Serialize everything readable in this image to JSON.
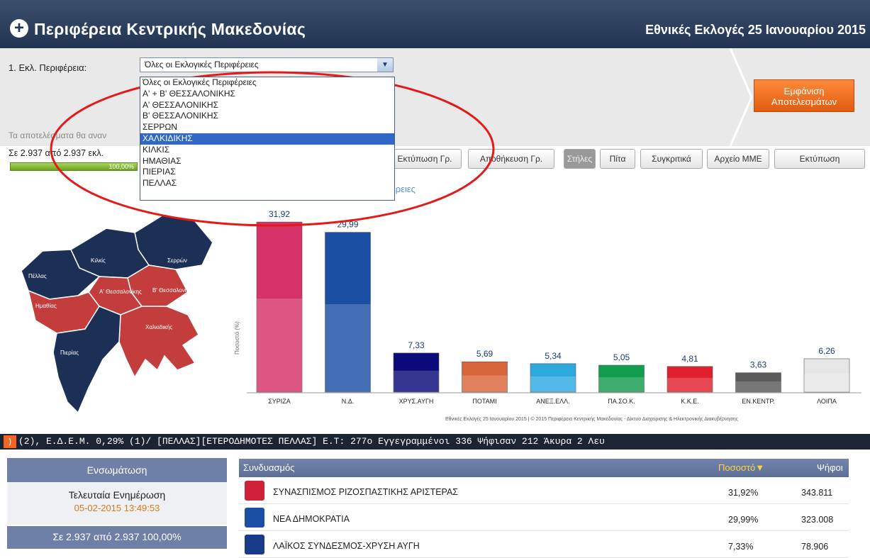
{
  "header": {
    "title": "Περιφέρεια Κεντρικής Μακεδονίας",
    "election": "Εθνικές Εκλογές 25 Ιανουαρίου 2015",
    "plus_glyph": "+"
  },
  "controls": {
    "region_label": "1. Εκλ. Περιφέρεια:",
    "region_selected": "Όλες οι Εκλογικές Περιφέρειες",
    "region_options": [
      "Όλες οι Εκλογικές Περιφέρειες",
      "Α' + Β' ΘΕΣΣΑΛΟΝΙΚΗΣ",
      "Α' ΘΕΣΣΑΛΟΝΙΚΗΣ",
      "Β' ΘΕΣΣΑΛΟΝΙΚΗΣ",
      "ΣΕΡΡΩΝ",
      "ΧΑΛΚΙΔΙΚΗΣ",
      "ΚΙΛΚΙΣ",
      "ΗΜΑΘΙΑΣ",
      "ΠΙΕΡΙΑΣ",
      "ΠΕΛΛΑΣ"
    ],
    "highlighted_option": 5,
    "notice": "Τα αποτελέσματα θα αναν",
    "show_button": [
      "Εμφάνιση",
      "Αποτελεσμάτων"
    ]
  },
  "status": {
    "stations": "Σε 2.937 από 2.937 εκλ.",
    "progress_label": "100,00%",
    "progress": 1.0
  },
  "tabs": [
    "Εκτύπωση Γρ.",
    "Αποθήκευση Γρ.",
    "Στήλες",
    "Πίτα",
    "Συγκριτικά",
    "Αρχείο ΜΜΕ",
    "Εκτύπωση"
  ],
  "active_tab": "Στήλες",
  "chart_title_fragment": "έρειες",
  "map": {
    "labels": [
      "Σερρών",
      "Κιλκίς",
      "Πέλλας",
      "Β' Θεσσαλονίκης",
      "Α' Θεσσαλονίκης",
      "Ημαθίας",
      "Χαλκιδικής",
      "Πιερίας"
    ]
  },
  "chart_data": {
    "type": "bar",
    "categories": [
      "ΣΥΡΙΖΑ",
      "Ν.Δ.",
      "ΧΡΥΣ.ΑΥΓΗ",
      "ΠΟΤΑΜΙ",
      "ΑΝΕΞ.ΕΛΛ.",
      "ΠΑ.ΣΟ.Κ.",
      "Κ.Κ.Ε.",
      "ΕΝ.ΚΕΝΤΡ.",
      "ΛΟΙΠΑ"
    ],
    "values": [
      31.92,
      29.99,
      7.33,
      5.69,
      5.34,
      5.05,
      4.81,
      3.63,
      6.26
    ],
    "value_labels": [
      "31,92",
      "29,99",
      "7,33",
      "5,69",
      "5,34",
      "5,05",
      "4,81",
      "3,63",
      "6,26"
    ],
    "colors": [
      "#d63168",
      "#1a4fa3",
      "#0a0a7a",
      "#d9653a",
      "#2ea9e0",
      "#139d4e",
      "#e0202e",
      "#5a5a5a",
      "#e6e6e6"
    ],
    "ylabel": "Ποσοστό (%)",
    "ylim": [
      0,
      33
    ]
  },
  "footnote": "Εθνικές Εκλογές 25 Ιανουαρίου 2015 | © 2015 Περιφέρεια Κεντρικής Μακεδονίας - Δίκτυο Διαχείρισης & Ηλεκτρονικής Διακυβέρνησης",
  "ticker": "(2),  Ε.Δ.Ε.Μ. 0,29% (1)/  [ΠΕΛΛΑΣ][ΕΤΕΡΟΔΗΜΟΤΕΣ ΠΕΛΛΑΣ]  Ε.Τ: 277ο  Εγγεγραμμένοι 336  Ψήφισαν 212  Άκυρα 2  Λευ",
  "left_panel": {
    "embed": "Ενσωμάτωση",
    "last_update_label": "Τελευταία Ενημέρωση",
    "last_update": "05-02-2015 13:49:53",
    "stat_line": "Σε 2.937 από 2.937  100,00%"
  },
  "results": {
    "columns": [
      "Συνδυασμός",
      "Ποσοστό",
      "Ψήφοι"
    ],
    "sort_arrow": "▼",
    "rows": [
      {
        "name": "ΣΥΝΑΣΠΙΣΜΟΣ ΡΙΖΟΣΠΑΣΤΙΚΗΣ ΑΡΙΣΤΕΡΑΣ",
        "pct": "31,92%",
        "votes": "343.811",
        "color": "#d0213a"
      },
      {
        "name": "ΝΕΑ ΔΗΜΟΚΡΑΤΙΑ",
        "pct": "29,99%",
        "votes": "323.008",
        "color": "#1a4fa3"
      },
      {
        "name": "ΛΑΪΚΟΣ ΣΥΝΔΕΣΜΟΣ-ΧΡΥΣΗ ΑΥΓΗ",
        "pct": "7,33%",
        "votes": "78.906",
        "color": "#1a3a8a"
      }
    ]
  }
}
